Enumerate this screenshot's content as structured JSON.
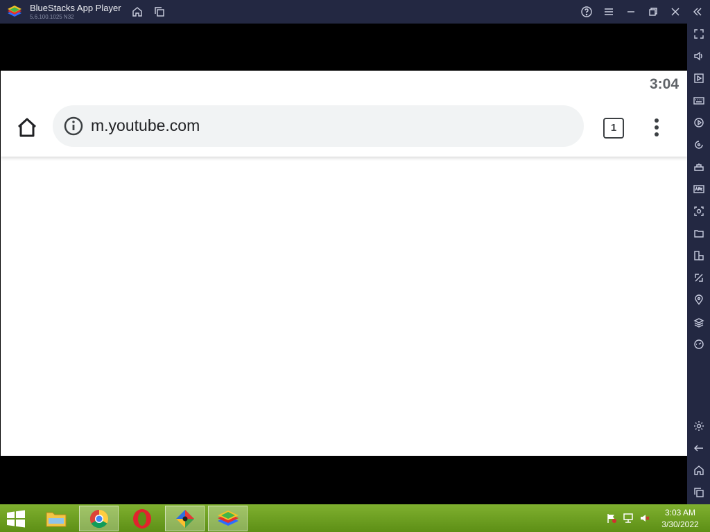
{
  "window": {
    "title": "BlueStacks App Player",
    "version": "5.6.100.1025 N32"
  },
  "android": {
    "status_time": "3:04",
    "url": "m.youtube.com",
    "tab_count": "1"
  },
  "taskbar": {
    "items": [
      "file-explorer",
      "chrome",
      "opera",
      "multicolor-app",
      "bluestacks"
    ],
    "time": "3:03 AM",
    "date": "3/30/2022"
  }
}
